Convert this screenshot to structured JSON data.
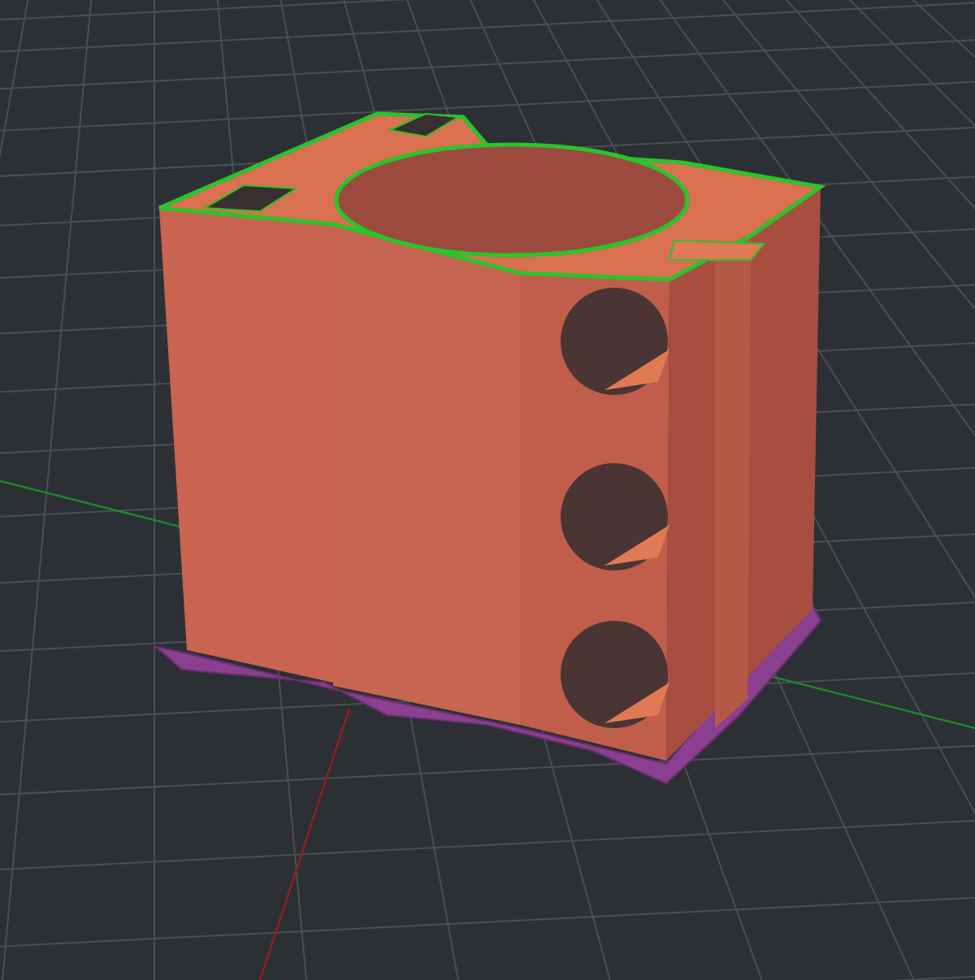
{
  "viewport": {
    "kind": "slice-preview"
  }
}
